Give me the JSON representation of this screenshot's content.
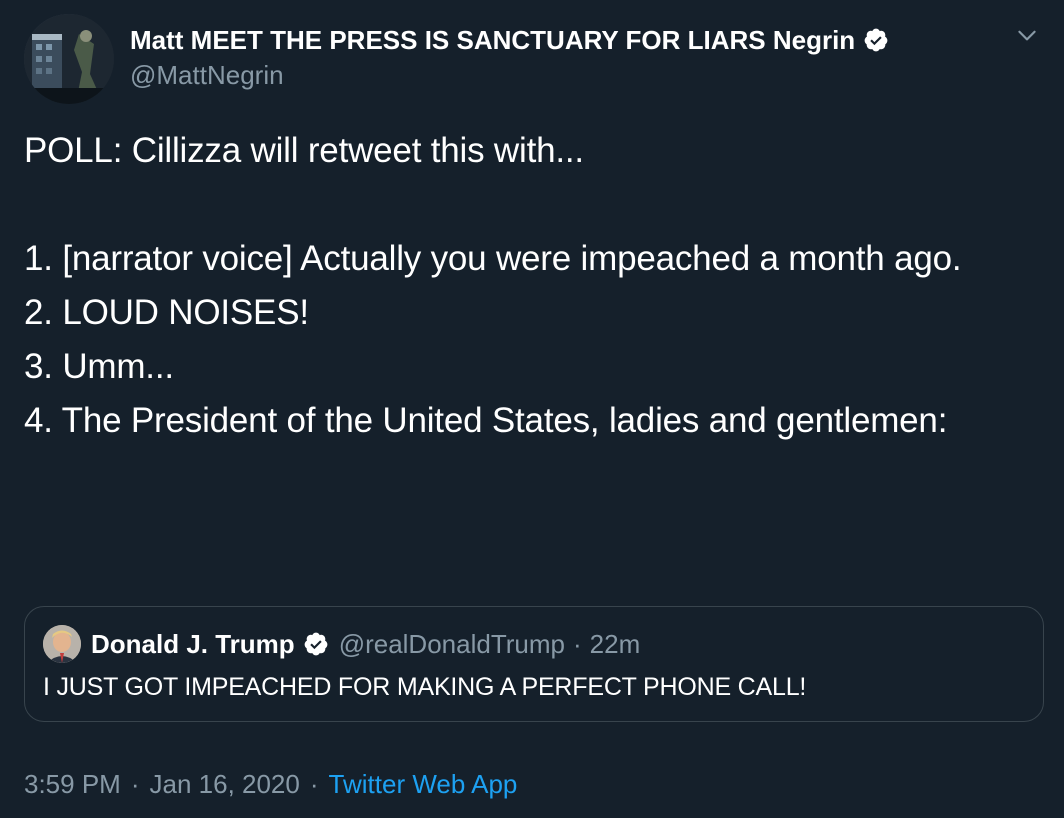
{
  "author": {
    "display_name": "Matt MEET THE PRESS IS SANCTUARY FOR LIARS Negrin",
    "handle": "@MattNegrin",
    "verified_icon": "verified-badge-icon",
    "avatar_icon": "profile-avatar"
  },
  "menu": {
    "chevron_icon": "chevron-down-icon"
  },
  "tweet": {
    "text": "POLL: Cillizza will retweet this with...\n\n1. [narrator voice] Actually you were impeached a month ago.\n2. LOUD NOISES!\n3. Umm...\n4. The President of the United States, ladies and gentlemen:"
  },
  "quoted_tweet": {
    "display_name": "Donald J. Trump",
    "handle": "@realDonaldTrump",
    "separator": "·",
    "time_ago": "22m",
    "text": "I JUST GOT IMPEACHED FOR MAKING A PERFECT PHONE CALL!"
  },
  "footer": {
    "time": "3:59 PM",
    "separator": "·",
    "date": "Jan 16, 2020",
    "separator2": "·",
    "source": "Twitter Web App"
  },
  "colors": {
    "background": "#15202b",
    "secondary_text": "#8899a6",
    "link": "#1da1f2",
    "border": "#38444d",
    "primary_text": "#ffffff"
  }
}
